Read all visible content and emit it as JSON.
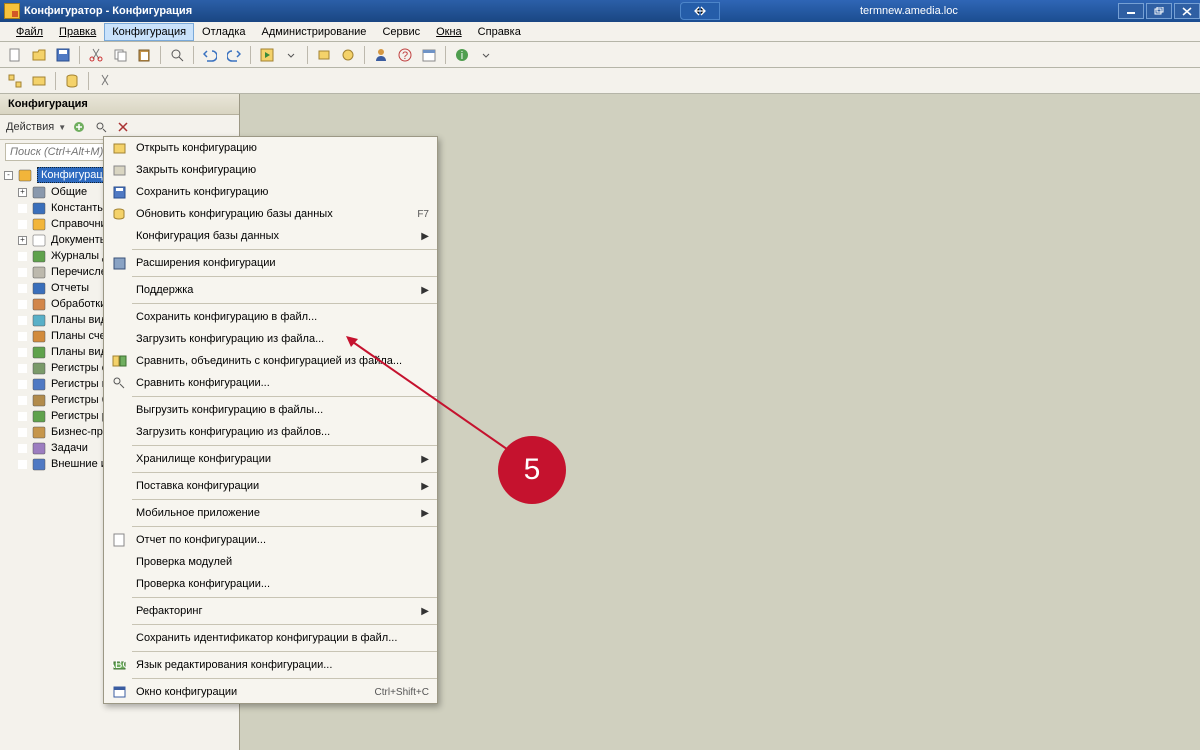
{
  "titlebar": {
    "title": "Конфигуратор - Конфигурация"
  },
  "server": {
    "label": "termnew.amedia.loc"
  },
  "menu": {
    "file": "Файл",
    "edit": "Правка",
    "config": "Конфигурация",
    "debug": "Отладка",
    "admin": "Администрирование",
    "service": "Сервис",
    "windows": "Окна",
    "help": "Справка"
  },
  "panel": {
    "title": "Конфигурация",
    "actions": "Действия",
    "search_placeholder": "Поиск (Ctrl+Alt+M)"
  },
  "tree": [
    {
      "label": "Конфигурация",
      "twist": "-",
      "sel": true,
      "icon": "globe"
    },
    {
      "label": "Общие",
      "twist": "+",
      "d": 1,
      "icon": "cog"
    },
    {
      "label": "Константы",
      "d": 1,
      "icon": "const"
    },
    {
      "label": "Справочник",
      "d": 1,
      "icon": "ref"
    },
    {
      "label": "Документы",
      "twist": "+",
      "d": 1,
      "icon": "doc"
    },
    {
      "label": "Журналы д",
      "d": 1,
      "icon": "journal"
    },
    {
      "label": "Перечислен",
      "d": 1,
      "icon": "enum"
    },
    {
      "label": "Отчеты",
      "d": 1,
      "icon": "report"
    },
    {
      "label": "Обработки",
      "d": 1,
      "icon": "process"
    },
    {
      "label": "Планы видо",
      "d": 1,
      "icon": "plan1"
    },
    {
      "label": "Планы счет",
      "d": 1,
      "icon": "plan2"
    },
    {
      "label": "Планы видо",
      "d": 1,
      "icon": "plan3"
    },
    {
      "label": "Регистры с",
      "d": 1,
      "icon": "reg1"
    },
    {
      "label": "Регистры н",
      "d": 1,
      "icon": "reg2"
    },
    {
      "label": "Регистры б",
      "d": 1,
      "icon": "reg3"
    },
    {
      "label": "Регистры р",
      "d": 1,
      "icon": "reg4"
    },
    {
      "label": "Бизнес-про",
      "d": 1,
      "icon": "biz"
    },
    {
      "label": "Задачи",
      "d": 1,
      "icon": "task"
    },
    {
      "label": "Внешние ис",
      "d": 1,
      "icon": "ext"
    }
  ],
  "dropdown": {
    "items": [
      {
        "label": "Открыть конфигурацию",
        "icon": "open"
      },
      {
        "label": "Закрыть конфигурацию",
        "icon": "close"
      },
      {
        "label": "Сохранить конфигурацию",
        "icon": "save"
      },
      {
        "label": "Обновить конфигурацию базы данных",
        "icon": "update",
        "shortcut": "F7"
      },
      {
        "label": "Конфигурация базы данных",
        "expand": true
      },
      {
        "sep": true
      },
      {
        "label": "Расширения конфигурации",
        "icon": "ext"
      },
      {
        "sep": true
      },
      {
        "label": "Поддержка",
        "expand": true
      },
      {
        "sep": true
      },
      {
        "label": "Сохранить конфигурацию в файл..."
      },
      {
        "label": "Загрузить конфигурацию из файла..."
      },
      {
        "label": "Сравнить, объединить с конфигурацией из файла...",
        "icon": "merge"
      },
      {
        "label": "Сравнить конфигурации...",
        "icon": "compare"
      },
      {
        "sep": true
      },
      {
        "label": "Выгрузить конфигурацию в файлы..."
      },
      {
        "label": "Загрузить конфигурацию из файлов..."
      },
      {
        "sep": true
      },
      {
        "label": "Хранилище конфигурации",
        "expand": true
      },
      {
        "sep": true
      },
      {
        "label": "Поставка конфигурации",
        "expand": true
      },
      {
        "sep": true
      },
      {
        "label": "Мобильное приложение",
        "expand": true
      },
      {
        "sep": true
      },
      {
        "label": "Отчет по конфигурации...",
        "icon": "rep"
      },
      {
        "label": "Проверка модулей"
      },
      {
        "label": "Проверка конфигурации..."
      },
      {
        "sep": true
      },
      {
        "label": "Рефакторинг",
        "expand": true
      },
      {
        "sep": true
      },
      {
        "label": "Сохранить идентификатор конфигурации в файл..."
      },
      {
        "sep": true
      },
      {
        "label": "Язык редактирования конфигурации...",
        "icon": "lang"
      },
      {
        "sep": true
      },
      {
        "label": "Окно конфигурации",
        "icon": "win",
        "shortcut": "Ctrl+Shift+C"
      }
    ]
  },
  "annotation": {
    "number": "5"
  }
}
